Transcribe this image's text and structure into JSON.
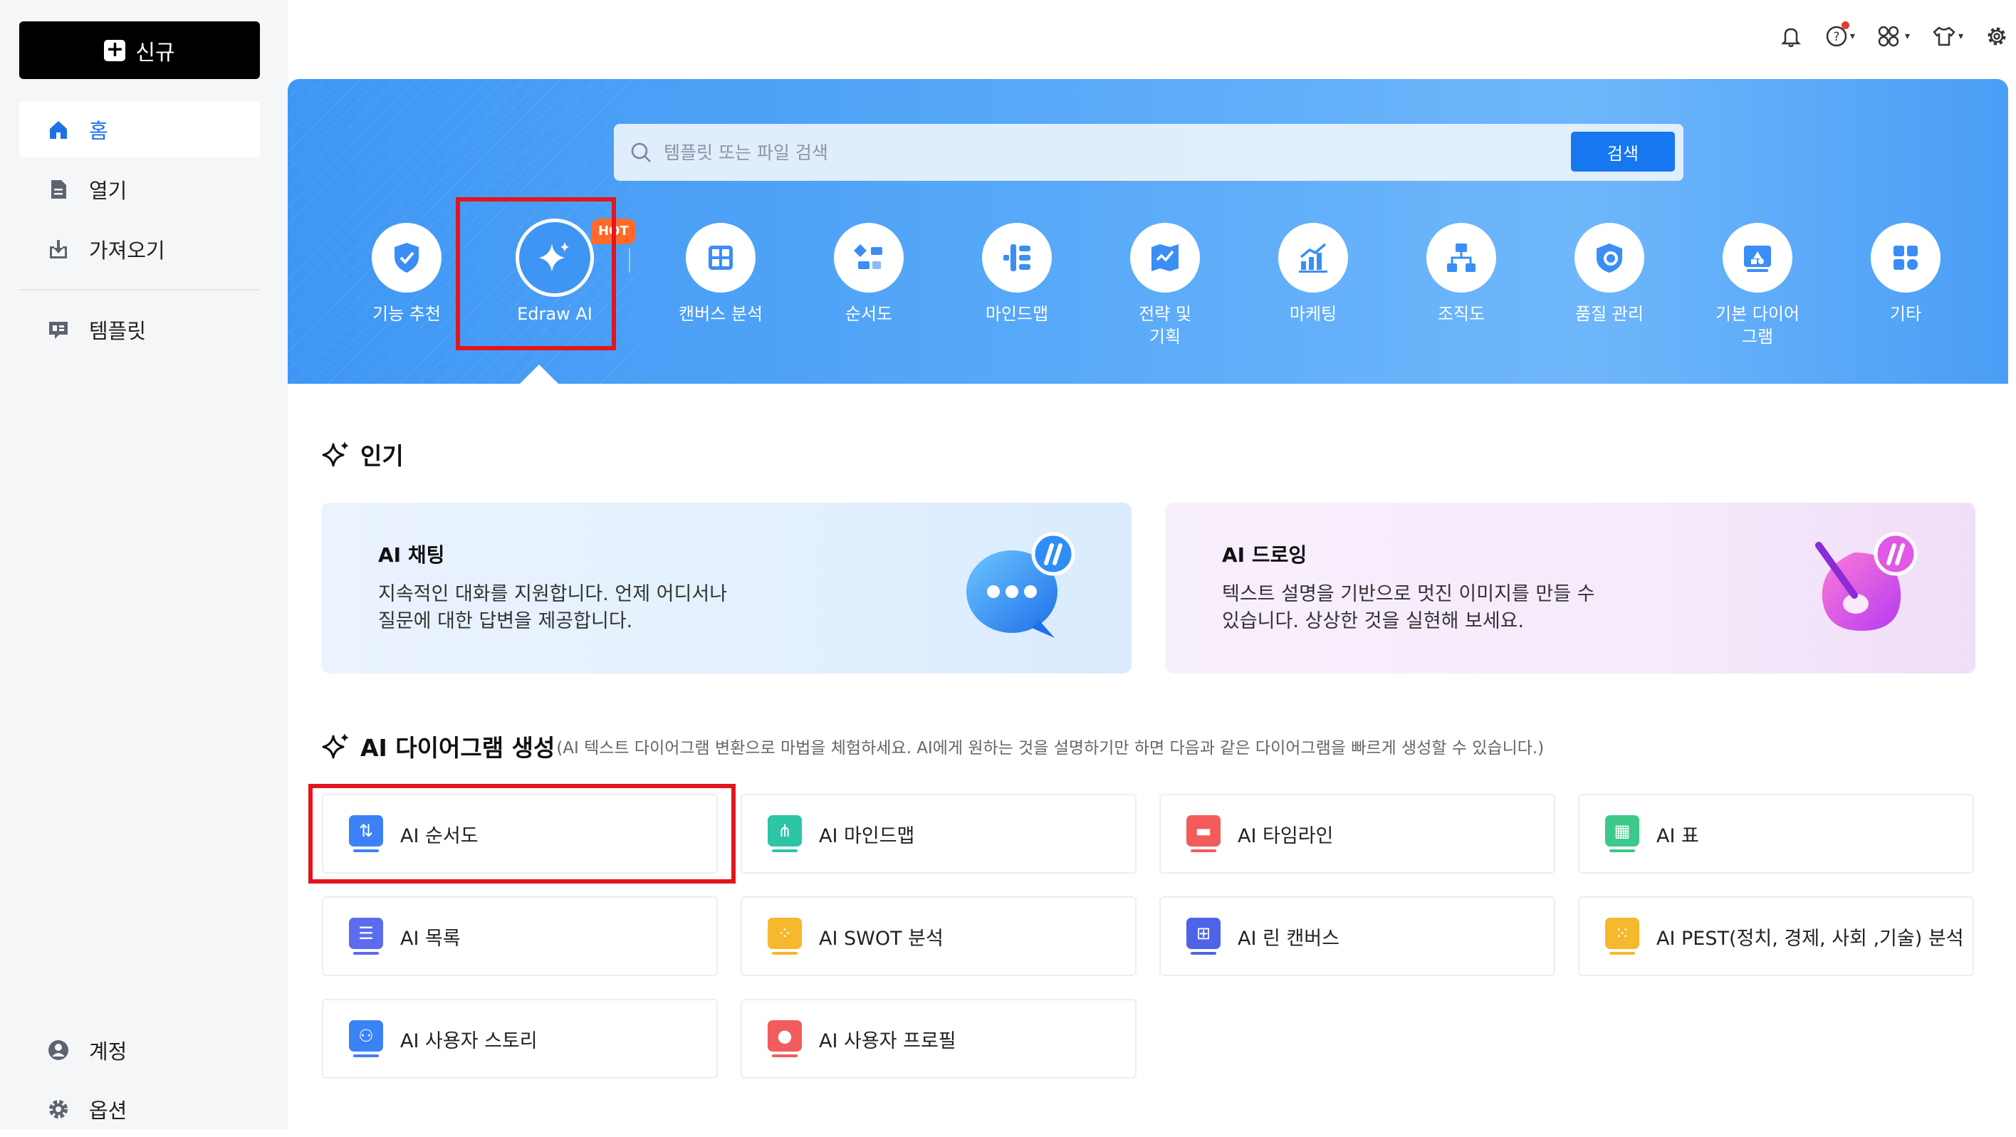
{
  "sidebar": {
    "new_label": "신규",
    "items": [
      {
        "label": "홈",
        "icon": "home-icon"
      },
      {
        "label": "열기",
        "icon": "file-icon"
      },
      {
        "label": "가져오기",
        "icon": "import-icon"
      },
      {
        "label": "템플릿",
        "icon": "template-icon"
      }
    ],
    "bottom": [
      {
        "label": "계정",
        "icon": "account-icon"
      },
      {
        "label": "옵션",
        "icon": "gear-icon"
      }
    ]
  },
  "topbar": {
    "icons": [
      "bell-icon",
      "help-icon",
      "apps-icon",
      "shirt-icon",
      "settings-icon"
    ]
  },
  "hero": {
    "search_placeholder": "템플릿 또는 파일 검색",
    "search_button": "검색",
    "categories": [
      {
        "label": "기능 추천",
        "icon": "feature-icon"
      },
      {
        "label": "Edraw AI",
        "icon": "ai-sparkle-icon",
        "badge": "HOT"
      },
      {
        "label": "캔버스 분석",
        "icon": "canvas-icon"
      },
      {
        "label": "순서도",
        "icon": "flowchart-icon"
      },
      {
        "label": "마인드맵",
        "icon": "mindmap-icon"
      },
      {
        "label": "전략 및 기획",
        "icon": "strategy-icon"
      },
      {
        "label": "마케팅",
        "icon": "marketing-icon"
      },
      {
        "label": "조직도",
        "icon": "orgchart-icon"
      },
      {
        "label": "품질 관리",
        "icon": "quality-icon"
      },
      {
        "label": "기본 다이어그램",
        "icon": "basic-diagram-icon"
      },
      {
        "label": "기타",
        "icon": "other-icon"
      }
    ]
  },
  "popular": {
    "title": "인기",
    "cards": [
      {
        "title": "AI 채팅",
        "desc_line1": "지속적인 대화를 지원합니다. 언제 어디서나",
        "desc_line2": "질문에 대한 답변을 제공합니다."
      },
      {
        "title": "AI 드로잉",
        "desc_line1": "텍스트 설명을 기반으로 멋진 이미지를 만들 수",
        "desc_line2": "있습니다. 상상한 것을 실현해 보세요."
      }
    ]
  },
  "ai_gen": {
    "title": "AI 다이어그램 생성",
    "subtitle": "(AI 텍스트 다이어그램 변환으로 마법을 체험하세요.  AI에게 원하는 것을 설명하기만 하면 다음과 같은 다이어그램을 빠르게 생성할 수 있습니다.)",
    "tiles": [
      {
        "label": "AI 순서도",
        "color": "#3b82f6"
      },
      {
        "label": "AI 마인드맵",
        "color": "#2ec4a6"
      },
      {
        "label": "AI 타임라인",
        "color": "#f25c5c"
      },
      {
        "label": "AI 표",
        "color": "#3cc98a"
      },
      {
        "label": "AI 목록",
        "color": "#5b6cf0"
      },
      {
        "label": "AI SWOT 분석",
        "color": "#f5b82e"
      },
      {
        "label": "AI 린 캔버스",
        "color": "#4f63e8"
      },
      {
        "label": "AI PEST(정치, 경제, 사회 ,기술) 분석",
        "color": "#f5b82e"
      },
      {
        "label": "AI 사용자 스토리",
        "color": "#3b82f6"
      },
      {
        "label": "AI 사용자 프로필",
        "color": "#f25c5c"
      }
    ]
  }
}
